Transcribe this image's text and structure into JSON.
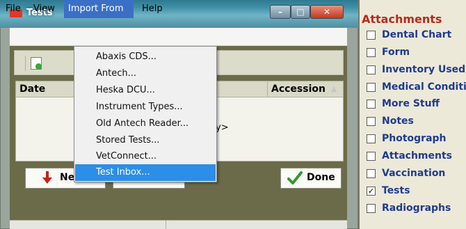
{
  "window": {
    "title": "Tests"
  },
  "menubar": {
    "file": "File",
    "view": "View",
    "import_from": "Import From",
    "help": "Help"
  },
  "import_menu": {
    "items": [
      "Abaxis CDS...",
      "Antech...",
      "Heska DCU...",
      "Instrument Types...",
      "Old Antech Reader...",
      "Stored Tests...",
      "VetConnect...",
      "Test Inbox..."
    ],
    "selected_index": 7
  },
  "grid": {
    "columns": {
      "date": "Date",
      "accession": "Accession"
    },
    "empty_text": "y>"
  },
  "buttons": {
    "new": "Ne",
    "done": "Done"
  },
  "attachments": {
    "title": "Attachments",
    "items": [
      {
        "label": "Dental Chart",
        "checked": false
      },
      {
        "label": "Form",
        "checked": false
      },
      {
        "label": "Inventory Used",
        "checked": false
      },
      {
        "label": "Medical Condition",
        "checked": false
      },
      {
        "label": "More Stuff",
        "checked": false
      },
      {
        "label": "Notes",
        "checked": false
      },
      {
        "label": "Photograph",
        "checked": false
      },
      {
        "label": "Attachments",
        "checked": false
      },
      {
        "label": "Vaccination",
        "checked": false
      },
      {
        "label": "Tests",
        "checked": true
      },
      {
        "label": "Radiographs",
        "checked": false
      }
    ]
  },
  "colors": {
    "menu_highlight": "#3b6fc6",
    "dropdown_selected": "#2c8ee8",
    "attachments_title": "#b82a1a",
    "attachment_label": "#1f3a8f"
  }
}
